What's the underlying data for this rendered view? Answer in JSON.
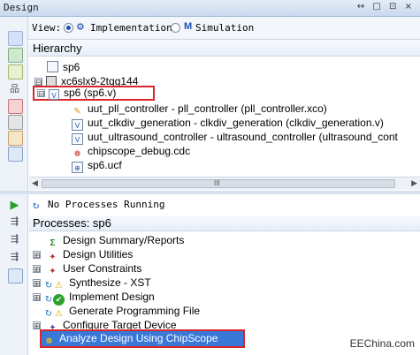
{
  "window": {
    "title": "Design",
    "controls": "↔ □ ⊡ ×"
  },
  "view": {
    "label": "View:",
    "options": [
      {
        "label": "Implementation",
        "selected": true
      },
      {
        "label": "Simulation",
        "selected": false
      }
    ]
  },
  "hierarchy": {
    "header": "Hierarchy",
    "items": [
      {
        "label": "sp6",
        "icon": "project-icon",
        "expander": ""
      },
      {
        "label": "xc6slx9-2tqg144",
        "icon": "chip-icon",
        "expander": "⊟"
      },
      {
        "label": "sp6 (sp6.v)",
        "icon": "verilog-module-icon",
        "expander": "⊟"
      },
      {
        "label": "uut_pll_controller - pll_controller (pll_controller.xco)",
        "icon": "ip-core-icon"
      },
      {
        "label": "uut_clkdiv_generation - clkdiv_generation (clkdiv_generation.v)",
        "icon": "verilog-file-icon"
      },
      {
        "label": "uut_ultrasound_controller - ultrasound_controller (ultrasound_cont",
        "icon": "verilog-file-icon"
      },
      {
        "label": "chipscope_debug.cdc",
        "icon": "chipscope-file-icon"
      },
      {
        "label": "sp6.ucf",
        "icon": "constraints-file-icon"
      }
    ],
    "scroll_label": "III"
  },
  "status": {
    "text": "No Processes Running"
  },
  "processes": {
    "header": "Processes: sp6",
    "items": [
      {
        "label": "Design Summary/Reports",
        "icon": "sigma-icon",
        "expander": ""
      },
      {
        "label": "Design Utilities",
        "icon": "tools-icon",
        "expander": "⊞"
      },
      {
        "label": "User Constraints",
        "icon": "tools-icon",
        "expander": "⊞"
      },
      {
        "label": "Synthesize - XST",
        "icon": "warning-icon",
        "expander": "⊞"
      },
      {
        "label": "Implement Design",
        "icon": "check-icon",
        "expander": "⊞"
      },
      {
        "label": "Generate Programming File",
        "icon": "warning-icon",
        "expander": ""
      },
      {
        "label": "Configure Target Device",
        "icon": "tools-icon",
        "expander": "⊞"
      },
      {
        "label": "Analyze Design Using ChipScope",
        "icon": "chipscope-icon",
        "expander": ""
      }
    ]
  },
  "watermark": "EEChina.com",
  "colors": {
    "selection": "#3a78d8",
    "annotation": "#d9262b",
    "accent": "#1f4fb0"
  }
}
